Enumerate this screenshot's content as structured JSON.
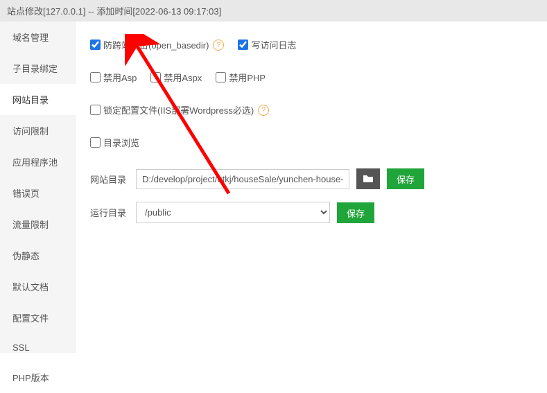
{
  "header": {
    "title": "站点修改[127.0.0.1] -- 添加时间[2022-06-13 09:17:03]"
  },
  "sidebar": {
    "items": [
      {
        "label": "域名管理"
      },
      {
        "label": "子目录绑定"
      },
      {
        "label": "网站目录"
      },
      {
        "label": "访问限制"
      },
      {
        "label": "应用程序池"
      },
      {
        "label": "错误页"
      },
      {
        "label": "流量限制"
      },
      {
        "label": "伪静态"
      },
      {
        "label": "默认文档"
      },
      {
        "label": "配置文件"
      },
      {
        "label": "SSL"
      },
      {
        "label": "PHP版本"
      }
    ],
    "active_index": 2
  },
  "form": {
    "opt1_label": "防跨站攻击(open_basedir)",
    "opt1_checked": true,
    "opt2_label": "写访问日志",
    "opt2_checked": true,
    "opt3_label": "禁用Asp",
    "opt3_checked": false,
    "opt4_label": "禁用Aspx",
    "opt4_checked": false,
    "opt5_label": "禁用PHP",
    "opt5_checked": false,
    "opt6_label": "锁定配置文件(IIS部署Wordpress必选)",
    "opt6_checked": false,
    "opt7_label": "目录浏览",
    "opt7_checked": false,
    "site_dir_label": "网站目录",
    "site_dir_value": "D:/develop/project/qtkj/houseSale/yunchen-house-sa",
    "run_dir_label": "运行目录",
    "run_dir_value": "/public",
    "save_label": "保存",
    "help_char": "?"
  }
}
